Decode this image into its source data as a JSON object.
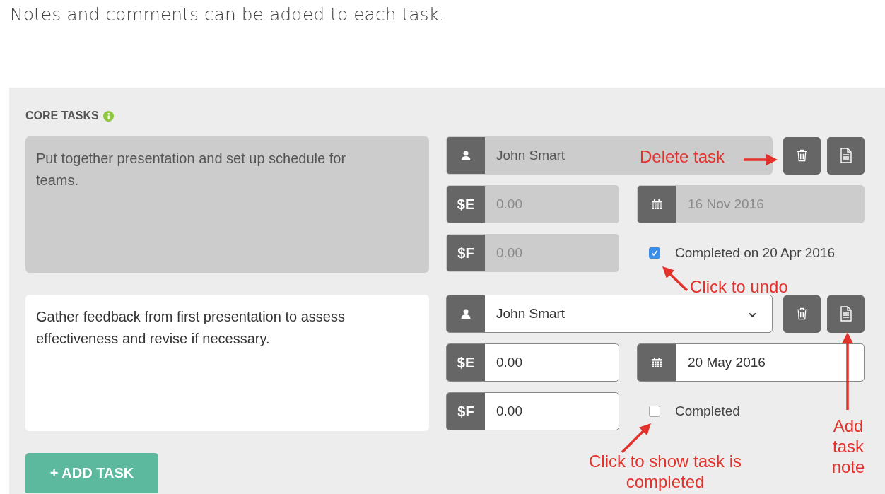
{
  "intro": "Notes and comments can be added to each task.",
  "section": {
    "title": "CORE TASKS"
  },
  "tasks": [
    {
      "description": "Put together presentation and set up schedule for teams.",
      "disabled": true,
      "assignee": "John Smart",
      "estimate_tag": "$E",
      "estimate": "0.00",
      "final_tag": "$F",
      "final": "0.00",
      "due_date": "16 Nov 2016",
      "completed": true,
      "completed_label": "Completed on 20 Apr 2016"
    },
    {
      "description": "Gather feedback from first presentation to assess effectiveness and revise if necessary.",
      "disabled": false,
      "assignee": "John Smart",
      "estimate_tag": "$E",
      "estimate": "0.00",
      "final_tag": "$F",
      "final": "0.00",
      "due_date": "20 May 2016",
      "completed": false,
      "completed_label": "Completed"
    }
  ],
  "add_button": "+ ADD TASK",
  "annotations": [
    {
      "text": "Delete task"
    },
    {
      "text": "Click to undo"
    },
    {
      "text": "Add task note"
    },
    {
      "text": "Click to show task is completed"
    }
  ]
}
